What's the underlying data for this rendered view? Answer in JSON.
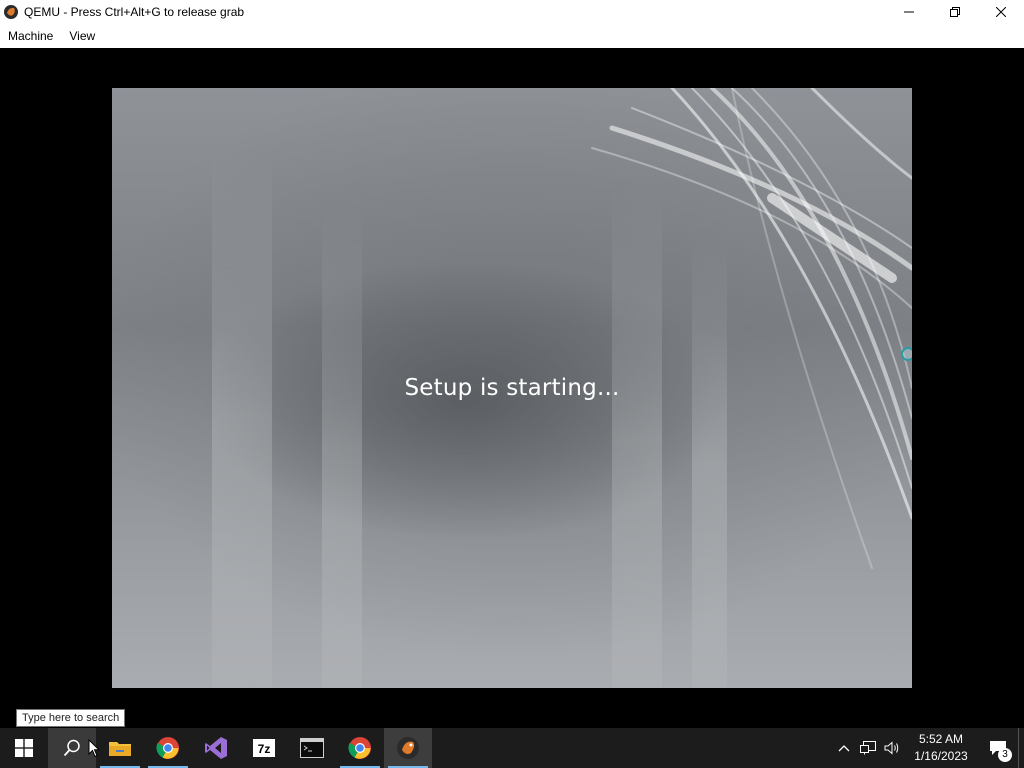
{
  "window": {
    "title": "QEMU - Press Ctrl+Alt+G to release grab",
    "icon": "qemu-icon",
    "controls": [
      "minimize-icon",
      "restore-icon",
      "close-icon"
    ]
  },
  "menubar": {
    "items": [
      {
        "label": "Machine"
      },
      {
        "label": "View"
      }
    ]
  },
  "guest": {
    "status_text": "Setup is starting..."
  },
  "tooltip": {
    "text": "Type here to search"
  },
  "taskbar": {
    "apps": [
      {
        "name": "start",
        "icon": "windows-logo-icon"
      },
      {
        "name": "search",
        "icon": "search-icon"
      },
      {
        "name": "file-explorer",
        "icon": "folder-icon"
      },
      {
        "name": "chrome",
        "icon": "chrome-icon"
      },
      {
        "name": "visual-studio",
        "icon": "visual-studio-icon"
      },
      {
        "name": "7zip",
        "icon": "7zip-icon"
      },
      {
        "name": "terminal",
        "icon": "terminal-icon"
      },
      {
        "name": "chrome-2",
        "icon": "chrome-icon"
      },
      {
        "name": "qemu",
        "icon": "qemu-icon"
      }
    ],
    "clock": {
      "time": "5:52 AM",
      "date": "1/16/2023"
    },
    "notifications": {
      "count": "3"
    },
    "colors": {
      "accent": "#76b9ed",
      "taskbar_bg": "#1c1c1c"
    }
  }
}
